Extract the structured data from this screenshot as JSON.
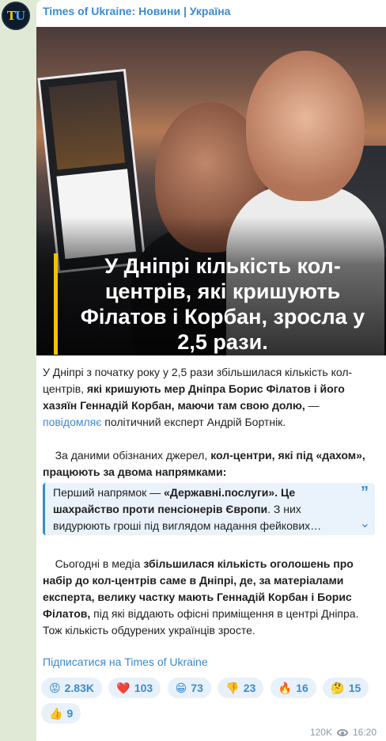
{
  "channel": {
    "avatar_text_a": "T",
    "avatar_text_b": "U",
    "name": "Times of Ukraine: Новини | Україна"
  },
  "post": {
    "image_headline": "У Дніпрі кількість кол-центрів, які кришують Філатов і Корбан, зросла у 2,5 рази.",
    "p1_a": "У Дніпрі з початку року у 2,5 рази збільшилася кількість кол-центрів,",
    "p1_b": " які кришують мер Дніпра Борис Філатов і його хазяїн Геннадій Корбан, маючи там свою долю,",
    "p1_c": " — ",
    "p1_link": "повідомляє",
    "p1_d": " політичний експерт Андрій Бортнік.",
    "p2_a": "За даними обізнаних джерел, ",
    "p2_b": "кол-центри, які під «дахом», працюють за двома напрямками:",
    "quote_a": "Перший напрямок — ",
    "quote_b": "«Державні.послуги». Це шахрайство проти пенсіонерів Європи",
    "quote_c": ". З них видурюють гроші під виглядом надання фейкових…",
    "p3_a": "Сьогодні в медіа ",
    "p3_b": "збільшилася кількість оголошень про набір до кол-центрів саме в Дніпрі, де, за матеріалами експерта, велику частку мають Геннадій Корбан і Борис Філатов,",
    "p3_c": " під які віддають офісні приміщення в центрі Дніпра. Тож кількість обдурених українців зросте.",
    "subscribe": "Підписатися на Times of Ukraine"
  },
  "reactions": [
    {
      "emoji": "😡",
      "count": "2.83K"
    },
    {
      "emoji": "❤️",
      "count": "103"
    },
    {
      "emoji": "😁",
      "count": "73"
    },
    {
      "emoji": "👎",
      "count": "23"
    },
    {
      "emoji": "🔥",
      "count": "16"
    },
    {
      "emoji": "🤔",
      "count": "15"
    },
    {
      "emoji": "👍",
      "count": "9"
    }
  ],
  "meta": {
    "views": "120K",
    "time": "16:20"
  }
}
